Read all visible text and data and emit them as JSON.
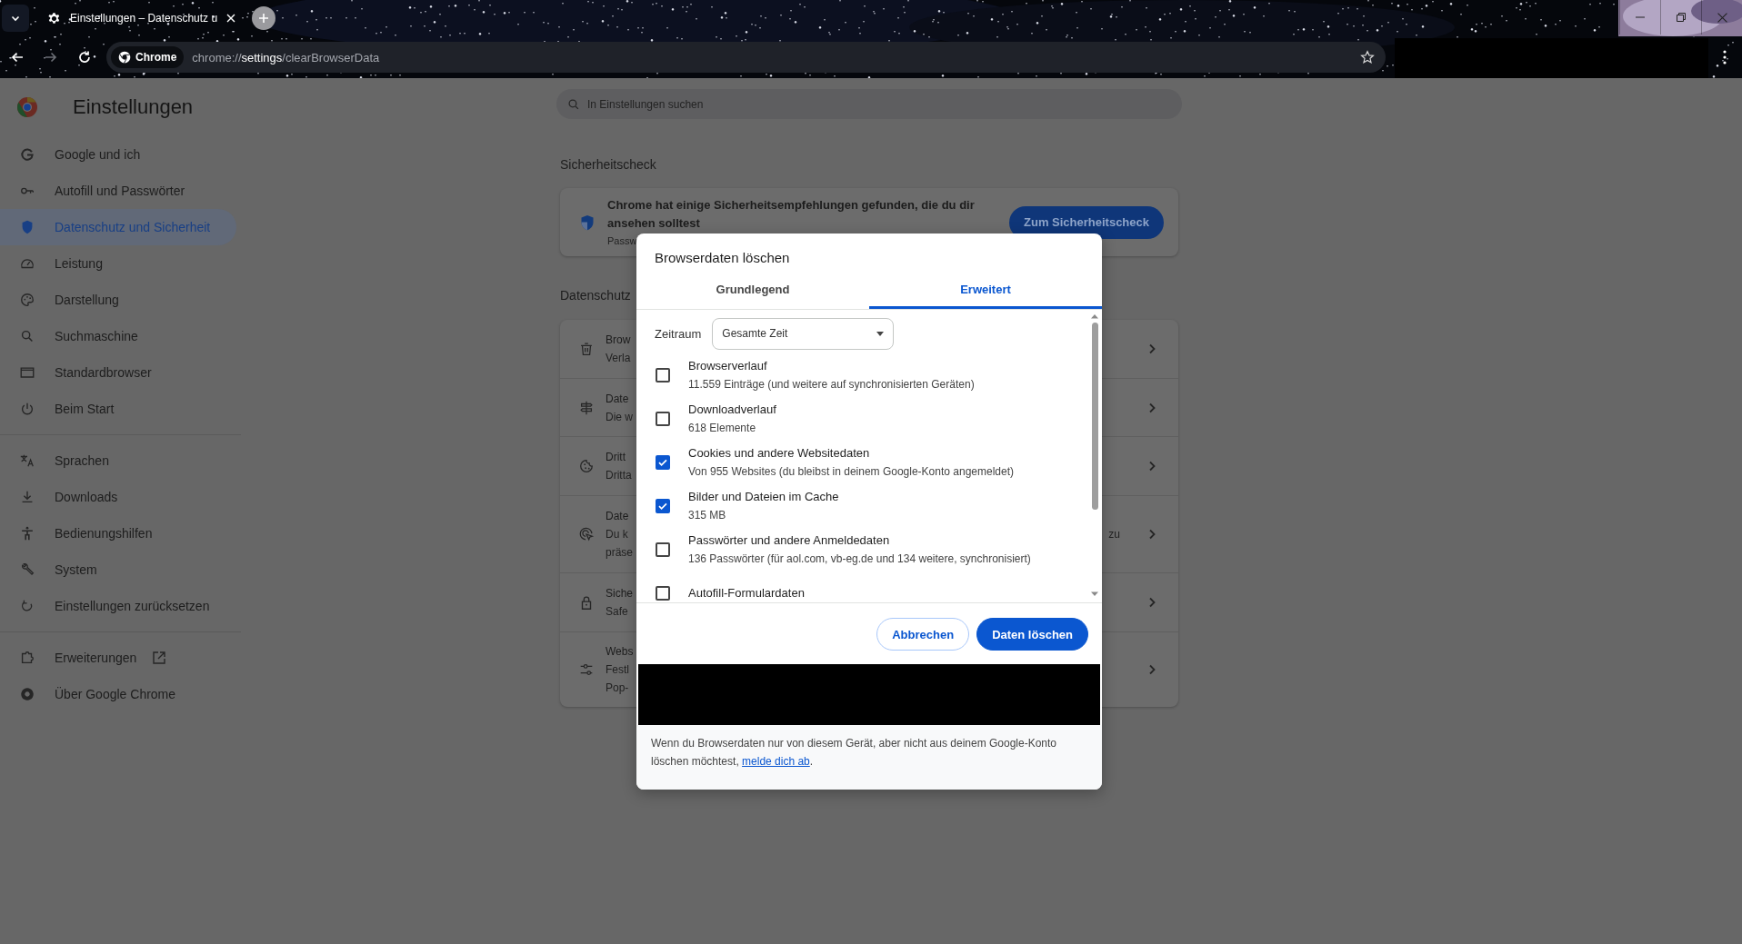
{
  "browser": {
    "tab": {
      "title": "Einstellungen – Datenschutz u"
    },
    "forward_disabled": true,
    "address_bar": {
      "chip": "Chrome",
      "url": "chrome://**settings**/clearBrowserData"
    }
  },
  "sidebar": {
    "title": "Einstellungen",
    "sections": [
      {
        "items": [
          {
            "label": "Google und ich",
            "selected": false,
            "external": false
          },
          {
            "label": "Autofill und Passwörter",
            "selected": false,
            "external": false
          },
          {
            "label": "Datenschutz und Sicherheit",
            "selected": true,
            "external": false
          },
          {
            "label": "Leistung",
            "selected": false,
            "external": false
          },
          {
            "label": "Darstellung",
            "selected": false,
            "external": false
          },
          {
            "label": "Suchmaschine",
            "selected": false,
            "external": false
          },
          {
            "label": "Standardbrowser",
            "selected": false,
            "external": false
          },
          {
            "label": "Beim Start",
            "selected": false,
            "external": false
          }
        ]
      },
      {
        "items": [
          {
            "label": "Sprachen",
            "selected": false,
            "external": false
          },
          {
            "label": "Downloads",
            "selected": false,
            "external": false
          },
          {
            "label": "Bedienungshilfen",
            "selected": false,
            "external": false
          },
          {
            "label": "System",
            "selected": false,
            "external": false
          },
          {
            "label": "Einstellungen zurücksetzen",
            "selected": false,
            "external": false
          }
        ]
      },
      {
        "items": [
          {
            "label": "Erweiterungen",
            "selected": false,
            "external": true
          },
          {
            "label": "Über Google Chrome",
            "selected": false,
            "external": false
          }
        ]
      }
    ]
  },
  "search": {
    "placeholder": "In Einstellungen suchen"
  },
  "safety_check": {
    "heading": "Sicherheitscheck",
    "message": "Chrome hat einige Sicherheitsempfehlungen gefunden, die du dir ansehen solltest",
    "detail": "Passw",
    "button": "Zum Sicherheitscheck"
  },
  "privacy": {
    "heading": "Datenschutz",
    "rows": [
      {
        "title": "Brow",
        "lines": [
          "Verla"
        ]
      },
      {
        "title": "Date",
        "lines": [
          "Die w"
        ]
      },
      {
        "title": "Dritt",
        "lines": [
          "Dritta"
        ]
      },
      {
        "title": "Date",
        "lines": [
          "Du k",
          "präse"
        ],
        "line_end": "zu"
      },
      {
        "title": "Siche",
        "lines": [
          "Safe"
        ]
      },
      {
        "title": "Webs",
        "lines": [
          "Festl",
          "Pop-"
        ]
      }
    ]
  },
  "dialog": {
    "title": "Browserdaten löschen",
    "tabs": [
      {
        "label": "Grundlegend",
        "selected": false
      },
      {
        "label": "Erweitert",
        "selected": true
      }
    ],
    "time_range": {
      "label": "Zeitraum",
      "value": "Gesamte Zeit"
    },
    "options": [
      {
        "label": "Browserverlauf",
        "detail": "11.559 Einträge (und weitere auf synchronisierten Geräten)",
        "checked": false
      },
      {
        "label": "Downloadverlauf",
        "detail": "618 Elemente",
        "checked": false
      },
      {
        "label": "Cookies und andere Websitedaten",
        "detail": "Von 955 Websites (du bleibst in deinem Google-Konto angemeldet)",
        "checked": true
      },
      {
        "label": "Bilder und Dateien im Cache",
        "detail": "315 MB",
        "checked": true
      },
      {
        "label": "Passwörter und andere Anmeldedaten",
        "detail": "136 Passwörter (für aol.com, vb-eg.de und 134 weitere, synchronisiert)",
        "checked": false
      },
      {
        "label": "Autofill-Formulardaten",
        "checked": false
      }
    ],
    "buttons": [
      {
        "label": "Abbrechen",
        "kind": "secondary"
      },
      {
        "label": "Daten löschen",
        "kind": "primary"
      }
    ],
    "note": "Wenn du Browserdaten nur von diesem Gerät, aber nicht aus deinem Google-Konto löschen möchtest, ",
    "note_link": "melde dich ab",
    "note_end": "."
  }
}
